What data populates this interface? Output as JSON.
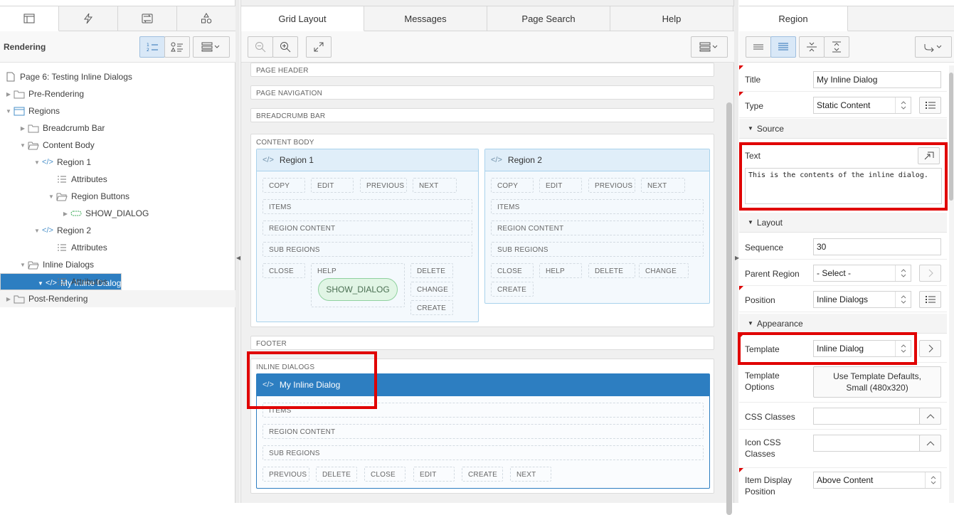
{
  "left_pane": {
    "tabs": [
      {
        "icon": "rendering-tree-icon"
      },
      {
        "icon": "dynamic-actions-icon"
      },
      {
        "icon": "processing-icon"
      },
      {
        "icon": "shared-components-icon"
      }
    ],
    "toolbar_label": "Rendering",
    "tree": [
      {
        "label": "Page 6: Testing Inline Dialogs",
        "depth": 0,
        "icon": "page-icon",
        "caret": ""
      },
      {
        "label": "Pre-Rendering",
        "depth": 0,
        "icon": "folder-icon",
        "caret": "right"
      },
      {
        "label": "Regions",
        "depth": 0,
        "icon": "regions-icon",
        "caret": "down"
      },
      {
        "label": "Breadcrumb Bar",
        "depth": 1,
        "icon": "folder-icon",
        "caret": "right"
      },
      {
        "label": "Content Body",
        "depth": 1,
        "icon": "folder-open-icon",
        "caret": "down"
      },
      {
        "label": "Region 1",
        "depth": 2,
        "icon": "code-icon",
        "caret": "down"
      },
      {
        "label": "Attributes",
        "depth": 3,
        "icon": "attributes-icon",
        "caret": ""
      },
      {
        "label": "Region Buttons",
        "depth": 3,
        "icon": "folder-open-icon",
        "caret": "down"
      },
      {
        "label": "SHOW_DIALOG",
        "depth": 4,
        "icon": "button-icon",
        "caret": "right"
      },
      {
        "label": "Region 2",
        "depth": 2,
        "icon": "code-icon",
        "caret": "down"
      },
      {
        "label": "Attributes",
        "depth": 3,
        "icon": "attributes-icon",
        "caret": ""
      },
      {
        "label": "Inline Dialogs",
        "depth": 1,
        "icon": "folder-open-icon",
        "caret": "down"
      },
      {
        "label": "My Inline Dialog",
        "depth": 2,
        "icon": "code-icon",
        "caret": "down",
        "selected": true
      },
      {
        "label": "Attributes",
        "depth": 3,
        "icon": "attributes-icon",
        "caret": ""
      },
      {
        "label": "Post-Rendering",
        "depth": 0,
        "icon": "folder-icon",
        "caret": "right"
      }
    ]
  },
  "center_pane": {
    "tabs": [
      "Grid Layout",
      "Messages",
      "Page Search",
      "Help"
    ],
    "active_tab": "Grid Layout",
    "bars": {
      "page_header": "PAGE HEADER",
      "page_navigation": "PAGE NAVIGATION",
      "breadcrumb_bar": "BREADCRUMB BAR",
      "footer": "FOOTER"
    },
    "content_body": {
      "caption": "CONTENT BODY",
      "region1": {
        "title": "Region 1",
        "top_buttons": [
          "COPY",
          "EDIT",
          "PREVIOUS",
          "NEXT"
        ],
        "items": "ITEMS",
        "region_content": "REGION CONTENT",
        "sub_regions": "SUB REGIONS",
        "close": "CLOSE",
        "help": "HELP",
        "show_dialog": "SHOW_DIALOG",
        "right_buttons": [
          "DELETE",
          "CHANGE",
          "CREATE"
        ]
      },
      "region2": {
        "title": "Region 2",
        "top_buttons": [
          "COPY",
          "EDIT",
          "PREVIOUS",
          "NEXT"
        ],
        "items": "ITEMS",
        "region_content": "REGION CONTENT",
        "sub_regions": "SUB REGIONS",
        "bottom_buttons": [
          "CLOSE",
          "HELP",
          "DELETE",
          "CHANGE"
        ],
        "create": "CREATE"
      }
    },
    "inline_dialogs": {
      "caption": "INLINE DIALOGS",
      "dialog": {
        "title": "My Inline Dialog",
        "items": "ITEMS",
        "region_content": "REGION CONTENT",
        "sub_regions": "SUB REGIONS",
        "bottom_buttons": [
          "PREVIOUS",
          "DELETE",
          "CLOSE",
          "EDIT",
          "CREATE",
          "NEXT"
        ]
      }
    }
  },
  "right_pane": {
    "tab": "Region",
    "props": {
      "title_label": "Title",
      "title_value": "My Inline Dialog",
      "type_label": "Type",
      "type_value": "Static Content",
      "source_group": "Source",
      "text_label": "Text",
      "text_value": "This is the contents of the inline dialog.",
      "layout_group": "Layout",
      "sequence_label": "Sequence",
      "sequence_value": "30",
      "parent_region_label": "Parent Region",
      "parent_region_value": "- Select -",
      "position_label": "Position",
      "position_value": "Inline Dialogs",
      "appearance_group": "Appearance",
      "template_label": "Template",
      "template_value": "Inline Dialog",
      "template_options_label_1": "Template",
      "template_options_label_2": "Options",
      "template_options_value_1": "Use Template Defaults,",
      "template_options_value_2": "Small (480x320)",
      "css_classes_label": "CSS Classes",
      "css_classes_value": "",
      "icon_css_label_1": "Icon CSS",
      "icon_css_label_2": "Classes",
      "icon_css_value": "",
      "item_display_label_1": "Item Display",
      "item_display_label_2": "Position",
      "item_display_value": "Above Content"
    }
  },
  "colors": {
    "selection": "#2d7ec1",
    "highlight_box": "#e00000",
    "button_pill": "#e1f5e5"
  }
}
